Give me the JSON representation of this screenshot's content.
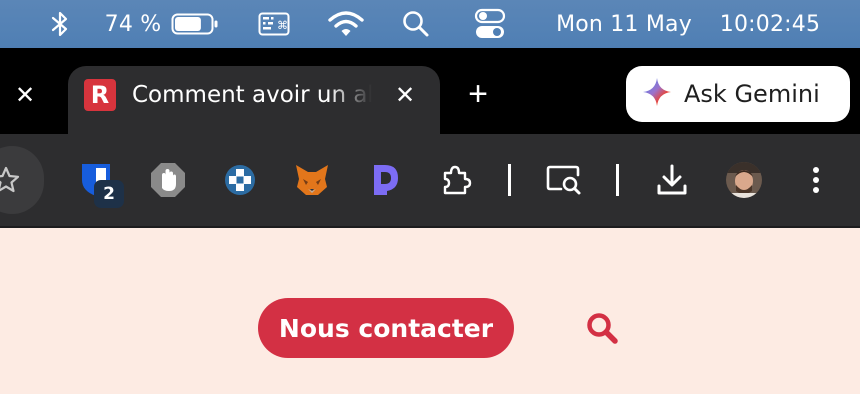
{
  "menubar": {
    "battery_percent": "74 %",
    "battery_level": 0.74,
    "date": "Mon 11 May",
    "time": "10:02:45",
    "icons": [
      "bluetooth-icon",
      "battery-icon",
      "keyboard-icon",
      "wifi-icon",
      "spotlight-icon",
      "control-center-icon"
    ]
  },
  "tabs": {
    "active_title": "Comment avoir un ab",
    "favicon_letter": "R",
    "favicon_color": "#d7343d",
    "close_symbol": "✕",
    "new_tab_symbol": "+"
  },
  "gemini": {
    "label": "Ask Gemini"
  },
  "toolbar": {
    "extensions_badge": "2",
    "icons": [
      "bookmark-star-icon",
      "bitwarden-icon",
      "hand-block-icon",
      "cross-extension-icon",
      "metamask-fox-icon",
      "dashlane-icon",
      "puzzle-extensions-icon",
      "screen-search-icon",
      "download-icon",
      "profile-avatar",
      "more-menu-icon"
    ]
  },
  "page": {
    "contact_label": "Nous contacter",
    "accent_color": "#d33044",
    "background_color": "#fdebe3"
  }
}
